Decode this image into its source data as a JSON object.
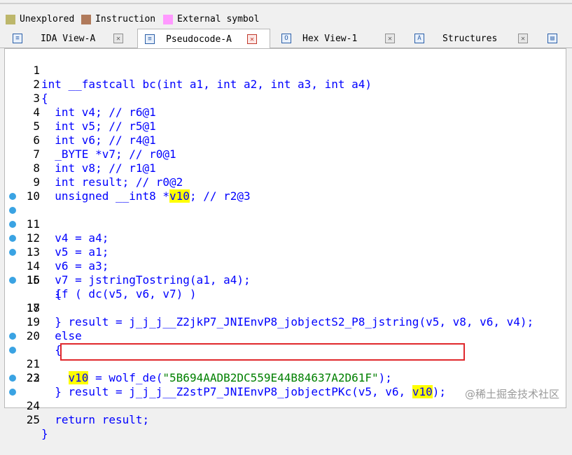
{
  "legend": {
    "items": [
      {
        "label": "Unexplored",
        "color": "#bdb76b"
      },
      {
        "label": "Instruction",
        "color": "#b07a5b"
      },
      {
        "label": "External symbol",
        "color": "#ff99ff"
      }
    ]
  },
  "tabs": [
    {
      "label": "IDA View-A",
      "icon": "ida-view-icon",
      "active": false
    },
    {
      "label": "Pseudocode-A",
      "icon": "pseudocode-icon",
      "active": true
    },
    {
      "label": "Hex View-1",
      "icon": "hex-view-icon",
      "active": false
    },
    {
      "label": "Structures",
      "icon": "structures-icon",
      "active": false
    }
  ],
  "code": {
    "line_numbers": [
      "1",
      "2",
      "3",
      "4",
      "5",
      "6",
      "7",
      "8",
      "9",
      "10",
      "11",
      "12",
      "13",
      "14",
      "15",
      "16",
      "17",
      "18",
      "19",
      "20",
      "21",
      "22",
      "23",
      "24",
      "25"
    ],
    "lines": [
      "int __fastcall bc(int a1, int a2, int a3, int a4)",
      "{",
      "  int v4; // r6@1",
      "  int v5; // r5@1",
      "  int v6; // r4@1",
      "  _BYTE *v7; // r0@1",
      "  int v8; // r1@1",
      "  int result; // r0@2",
      "  unsigned __int8 *v10; // r2@3",
      "",
      "  v4 = a4;",
      "  v5 = a1;",
      "  v6 = a3;",
      "  v7 = jstringTostring(a1, a4);",
      "  if ( dc(v5, v6, v7) )",
      "  {",
      "    result = j_j_j__Z2jkP7_JNIEnvP8_jobjectS2_P8_jstring(v5, v8, v6, v4);",
      "  }",
      "  else",
      "  {",
      "    v10 = wolf_de(\"5B694AADB2DC559E44B84637A2D61F\");",
      "    result = j_j_j__Z2stP7_JNIEnvP8_jobjectPKc(v5, v6, v10);",
      "  }",
      "  return result;",
      "}"
    ]
  },
  "watermark": "@稀土掘金技术社区"
}
